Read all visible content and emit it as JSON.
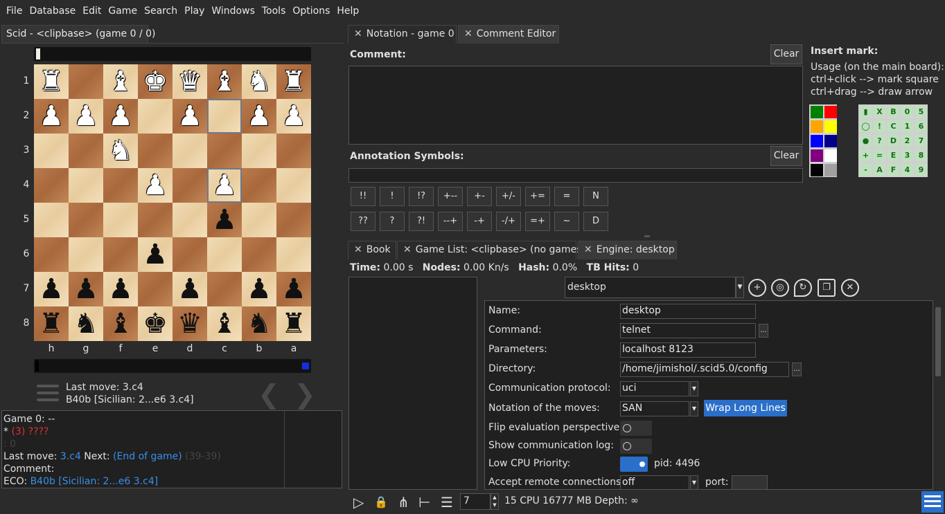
{
  "menu": [
    "File",
    "Database",
    "Edit",
    "Game",
    "Search",
    "Play",
    "Windows",
    "Tools",
    "Options",
    "Help"
  ],
  "left_tab": "Scid - <clipbase> (game 0 / 0)",
  "board": {
    "ranks": [
      "1",
      "2",
      "3",
      "4",
      "5",
      "6",
      "7",
      "8"
    ],
    "files": [
      "h",
      "g",
      "f",
      "e",
      "d",
      "c",
      "b",
      "a"
    ],
    "pieces": [
      [
        "♜w",
        "",
        "♝w",
        "♚w",
        "♛w",
        "♝w",
        "♞w",
        "♜w"
      ],
      [
        "♟w",
        "♟w",
        "♟w",
        "",
        "♟w",
        "",
        "♟w",
        "♟w"
      ],
      [
        "",
        "",
        "♞w",
        "",
        "",
        "",
        "",
        ""
      ],
      [
        "",
        "",
        "",
        "♟w",
        "",
        "♟w",
        "",
        ""
      ],
      [
        "",
        "",
        "",
        "",
        "",
        "♟b",
        "",
        ""
      ],
      [
        "",
        "",
        "",
        "♟b",
        "",
        "",
        "",
        ""
      ],
      [
        "♟b",
        "♟b",
        "♟b",
        "",
        "♟b",
        "",
        "♟b",
        "♟b"
      ],
      [
        "♜b",
        "♞b",
        "♝b",
        "♚b",
        "♛b",
        "♝b",
        "♞b",
        "♜b"
      ]
    ],
    "highlighted": [
      "c2",
      "c4"
    ]
  },
  "move_info": {
    "last_move": "Last move: 3.c4",
    "opening": "B40b [Sicilian: 2...e6 3.c4]",
    "prev_glyph": "❮",
    "next_glyph": "❯"
  },
  "game_info": {
    "line1": "Game 0:    --",
    "line2_star": "* ",
    "line2_red": "(3)   ????",
    "line3": ":   0",
    "lastmove_label": "Last move: ",
    "lastmove_value": "3.c4",
    "next_label": "   Next: ",
    "next_value": "(End of game)",
    "next_grey": "   (39-39)",
    "comment_label": "Comment:",
    "eco_label": "ECO:  ",
    "eco_value": "B40b [Sicilian: 2...e6 3.c4]"
  },
  "top_tabs": [
    {
      "label": "Notation - game 0",
      "close": "✕"
    },
    {
      "label": "Comment Editor",
      "close": "✕"
    }
  ],
  "comment_editor": {
    "comment_label": "Comment:",
    "clear_label": "Clear",
    "annotation_label": "Annotation Symbols:",
    "symbols_row1": [
      "!!",
      "!",
      "!?",
      "+--",
      "+-",
      "+/-",
      "+=",
      "=",
      "N"
    ],
    "symbols_row2": [
      "??",
      "?",
      "?!",
      "--+",
      "-+",
      "-/+",
      "=+",
      "~",
      "D"
    ],
    "insert_mark_title": "Insert mark:",
    "usage": [
      "Usage (on the main board):",
      "ctrl+click --> mark square",
      "ctrl+drag --> draw arrow"
    ],
    "colors": [
      "#008000",
      "#ff0000",
      "#ffa500",
      "#ffff00",
      "#0000ff",
      "#00008b",
      "#800080",
      "#ffffff",
      "#000000",
      "#a0a0a0"
    ],
    "marks": [
      [
        "▮",
        "X",
        "B",
        "0",
        "5"
      ],
      [
        "◯",
        "!",
        "C",
        "1",
        "6"
      ],
      [
        "●",
        "?",
        "D",
        "2",
        "7"
      ],
      [
        "+",
        "=",
        "E",
        "3",
        "8"
      ],
      [
        "-",
        "A",
        "F",
        "4",
        "9"
      ]
    ]
  },
  "bottom_tabs": [
    {
      "label": "Book",
      "close": "✕"
    },
    {
      "label": "Game List: <clipbase> (no games)",
      "close": "✕"
    },
    {
      "label": "Engine: desktop",
      "close": "✕"
    }
  ],
  "engine": {
    "time_label": "Time:",
    "time_value": "0.00 s",
    "nodes_label": "Nodes:",
    "nodes_value": "0.00 Kn/s",
    "hash_label": "Hash:",
    "hash_value": "0.0%",
    "tb_label": "TB Hits:",
    "tb_value": "0",
    "selected": "desktop",
    "icons": [
      "plus-icon",
      "globe-icon",
      "reload-icon",
      "copy-icon",
      "close-icon"
    ],
    "icon_glyphs": [
      "+",
      "◎",
      "↻",
      "❐",
      "✕"
    ],
    "config": {
      "name_label": "Name:",
      "name": "desktop",
      "command_label": "Command:",
      "command": "telnet",
      "params_label": "Parameters:",
      "params": "localhost 8123",
      "dir_label": "Directory:",
      "dir": "/home/jimishol/.scid5.0/config",
      "protocol_label": "Communication protocol:",
      "protocol": "uci",
      "notation_label": "Notation of the moves:",
      "notation": "SAN",
      "wrap_label": "Wrap Long Lines",
      "flip_label": "Flip evaluation perspective:",
      "log_label": "Show communication log:",
      "lowcpu_label": "Low CPU Priority:",
      "pid": "pid: 4496",
      "remote_label": "Accept remote connections:",
      "remote": "off",
      "port_label": "port:",
      "dots": "..."
    },
    "depth": "7",
    "cpu_info": "15 CPU  16777 MB  Depth: ∞",
    "toolbar_icons": [
      "▷",
      "🔒",
      "⋔",
      "⊢",
      "☰"
    ]
  }
}
